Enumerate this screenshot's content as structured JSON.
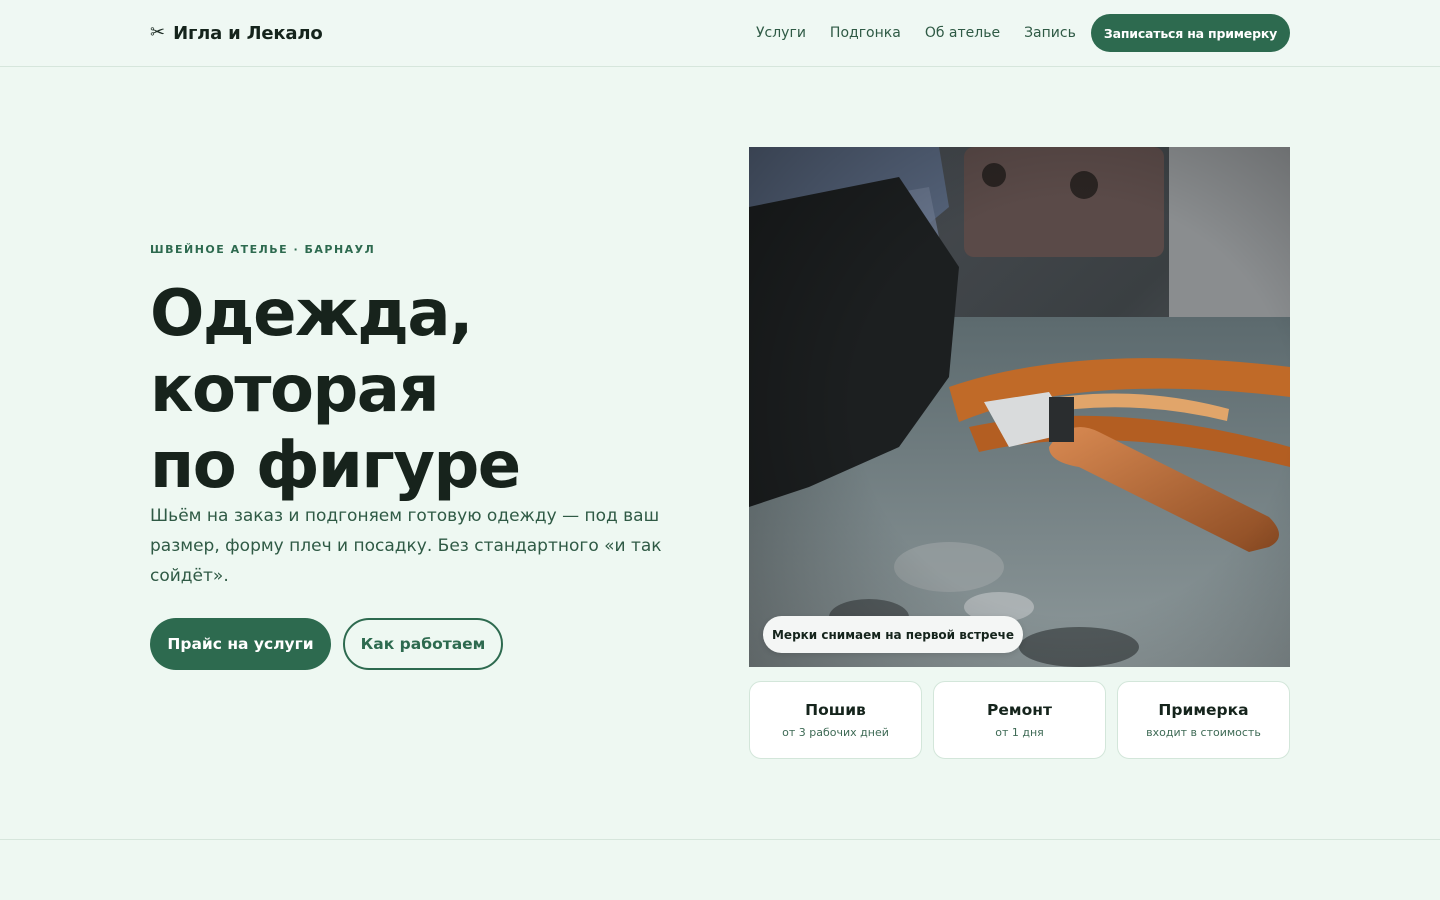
{
  "header": {
    "logo_icon": "scissors-icon",
    "logo_glyph": "✂",
    "brand": "Игла и Лекало",
    "nav": [
      "Услуги",
      "Подгонка",
      "Об ателье",
      "Запись"
    ],
    "cta": "Записаться на примерку"
  },
  "hero": {
    "eyebrow": "ШВЕЙНОЕ АТЕЛЬЕ · БАРНАУЛ",
    "title_lines": [
      "Одежда,",
      "которая",
      "по фигуре"
    ],
    "text": "Шьём на заказ и подгоняем готовую одежду — под ваш размер, форму плеч и посадку. Без стандартного «и так сойдёт».",
    "primary_button": "Прайс на услуги",
    "secondary_button": "Как работаем"
  },
  "photo": {
    "badge": "Мерки снимаем на первой встрече"
  },
  "cards": [
    {
      "title": "Пошив",
      "subtitle": "от 3 рабочих дней"
    },
    {
      "title": "Ремонт",
      "subtitle": "от 1 дня"
    },
    {
      "title": "Примерка",
      "subtitle": "входит в стоимость"
    }
  ],
  "colors": {
    "accent": "#2d6a4f",
    "background": "#eef8f2",
    "text": "#15241c"
  }
}
